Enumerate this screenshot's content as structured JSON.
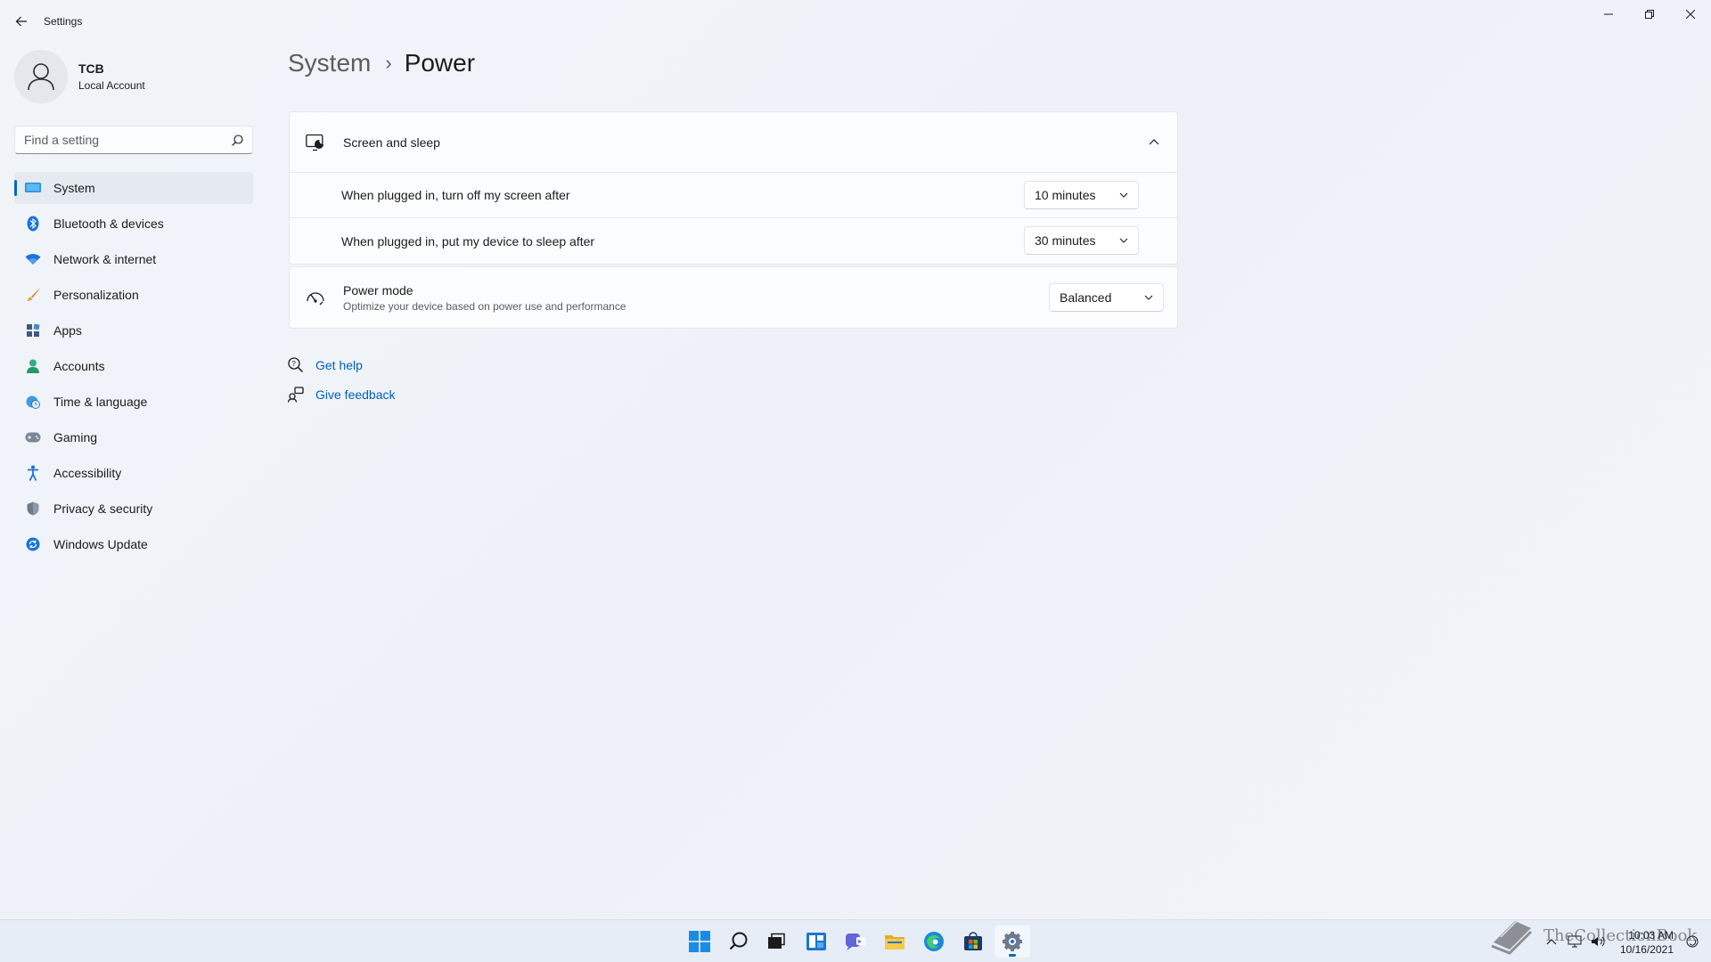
{
  "window": {
    "title": "Settings",
    "back_icon": "arrow-left-icon",
    "controls": [
      "minimize-icon",
      "restore-icon",
      "close-icon"
    ]
  },
  "profile": {
    "name": "TCB",
    "account_type": "Local Account",
    "avatar_icon": "person-icon"
  },
  "search": {
    "placeholder": "Find a setting",
    "icon": "search-icon"
  },
  "nav": {
    "items": [
      {
        "label": "System",
        "icon": "display-icon",
        "active": true
      },
      {
        "label": "Bluetooth & devices",
        "icon": "bluetooth-icon"
      },
      {
        "label": "Network & internet",
        "icon": "wifi-icon"
      },
      {
        "label": "Personalization",
        "icon": "brush-icon"
      },
      {
        "label": "Apps",
        "icon": "apps-icon"
      },
      {
        "label": "Accounts",
        "icon": "person-icon"
      },
      {
        "label": "Time & language",
        "icon": "globe-clock-icon"
      },
      {
        "label": "Gaming",
        "icon": "gamepad-icon"
      },
      {
        "label": "Accessibility",
        "icon": "accessibility-icon"
      },
      {
        "label": "Privacy & security",
        "icon": "shield-icon"
      },
      {
        "label": "Windows Update",
        "icon": "update-icon"
      }
    ]
  },
  "breadcrumb": {
    "parent": "System",
    "separator": "›",
    "current": "Power"
  },
  "screen_sleep": {
    "title": "Screen and sleep",
    "expanded": true,
    "rows": [
      {
        "label": "When plugged in, turn off my screen after",
        "value": "10 minutes"
      },
      {
        "label": "When plugged in, put my device to sleep after",
        "value": "30 minutes"
      }
    ]
  },
  "power_mode": {
    "title": "Power mode",
    "description": "Optimize your device based on power use and performance",
    "value": "Balanced"
  },
  "help": {
    "get_help": "Get help",
    "give_feedback": "Give feedback"
  },
  "taskbar": {
    "icons": [
      "start-icon",
      "search-icon",
      "task-view-icon",
      "widgets-icon",
      "chat-icon",
      "file-explorer-icon",
      "edge-icon",
      "store-icon",
      "settings-icon"
    ],
    "clock_time": "10:03 AM",
    "clock_date": "10/16/2021",
    "watermark": "TheCollectionBook"
  },
  "colors": {
    "accent": "#0067c0",
    "link": "#005fb8",
    "background": "#eef2f8"
  }
}
